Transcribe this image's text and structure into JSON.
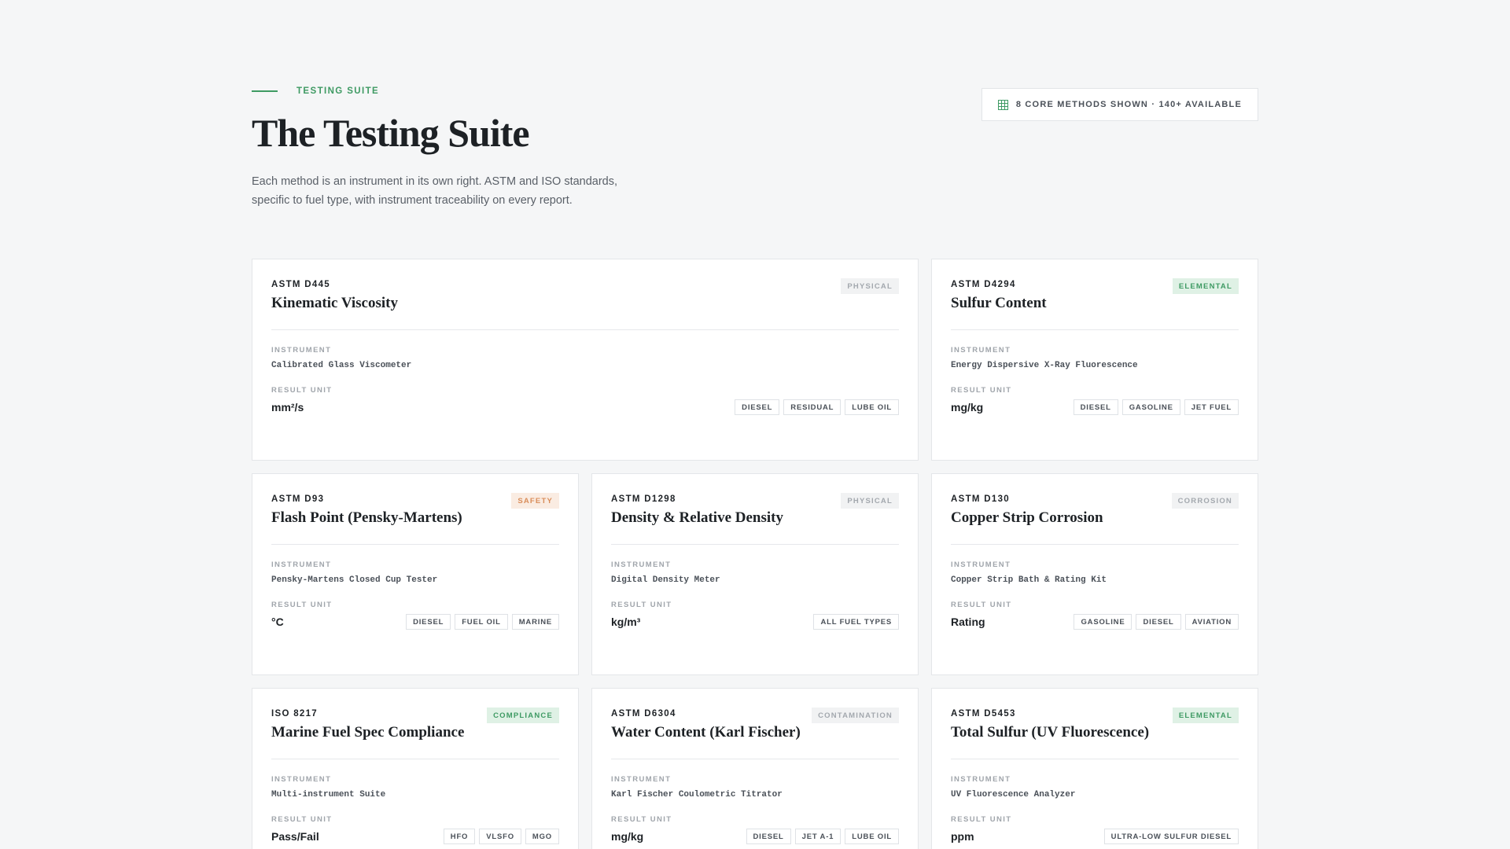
{
  "header": {
    "eyebrow": "TESTING SUITE",
    "title": "The Testing Suite",
    "subtitle": "Each method is an instrument in its own right. ASTM and ISO standards, specific to fuel type, with instrument traceability on every report.",
    "count_badge": "8 CORE METHODS SHOWN · 140+ AVAILABLE",
    "count_icon": "grid-icon"
  },
  "labels": {
    "instrument": "INSTRUMENT",
    "result_unit": "RESULT UNIT"
  },
  "colors": {
    "accent": "#3e9a63",
    "safety": "#d98d5a",
    "neutral_badge": "#a3a8ae"
  },
  "methods": [
    {
      "code": "ASTM D445",
      "title": "Kinematic Viscosity",
      "category": "PHYSICAL",
      "instrument": "Calibrated Glass Viscometer",
      "unit": "mm²/s",
      "tags": [
        "DIESEL",
        "RESIDUAL",
        "LUBE OIL"
      ]
    },
    {
      "code": "ASTM D4294",
      "title": "Sulfur Content",
      "category": "ELEMENTAL",
      "instrument": "Energy Dispersive X-Ray Fluorescence",
      "unit": "mg/kg",
      "tags": [
        "DIESEL",
        "GASOLINE",
        "JET FUEL"
      ]
    },
    {
      "code": "ASTM D93",
      "title": "Flash Point (Pensky-Martens)",
      "category": "SAFETY",
      "instrument": "Pensky-Martens Closed Cup Tester",
      "unit": "°C",
      "tags": [
        "DIESEL",
        "FUEL OIL",
        "MARINE"
      ]
    },
    {
      "code": "ASTM D1298",
      "title": "Density & Relative Density",
      "category": "PHYSICAL",
      "instrument": "Digital Density Meter",
      "unit": "kg/m³",
      "tags": [
        "ALL FUEL TYPES"
      ]
    },
    {
      "code": "ASTM D130",
      "title": "Copper Strip Corrosion",
      "category": "CORROSION",
      "instrument": "Copper Strip Bath & Rating Kit",
      "unit": "Rating",
      "tags": [
        "GASOLINE",
        "DIESEL",
        "AVIATION"
      ]
    },
    {
      "code": "ISO 8217",
      "title": "Marine Fuel Spec Compliance",
      "category": "COMPLIANCE",
      "instrument": "Multi-instrument Suite",
      "unit": "Pass/Fail",
      "tags": [
        "HFO",
        "VLSFO",
        "MGO"
      ]
    },
    {
      "code": "ASTM D6304",
      "title": "Water Content (Karl Fischer)",
      "category": "CONTAMINATION",
      "instrument": "Karl Fischer Coulometric Titrator",
      "unit": "mg/kg",
      "tags": [
        "DIESEL",
        "JET A-1",
        "LUBE OIL"
      ]
    },
    {
      "code": "ASTM D5453",
      "title": "Total Sulfur (UV Fluorescence)",
      "category": "ELEMENTAL",
      "instrument": "UV Fluorescence Analyzer",
      "unit": "ppm",
      "tags": [
        "ULTRA-LOW SULFUR DIESEL"
      ]
    }
  ]
}
